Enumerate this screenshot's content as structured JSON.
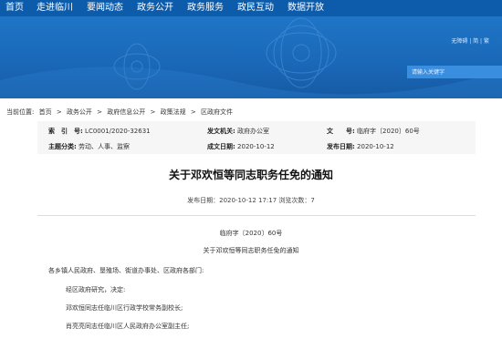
{
  "nav": {
    "items": [
      "首页",
      "走进临川",
      "要闻动态",
      "政务公开",
      "政务服务",
      "政民互动",
      "数据开放"
    ]
  },
  "header": {
    "accessibility_links": "无障碍 | 简 | 繁",
    "search_placeholder": "请输入关键字"
  },
  "breadcrumb": {
    "prefix": "当前位置:",
    "items": [
      "首页",
      "政务公开",
      "政府信息公开",
      "政策法规",
      "区政府文件"
    ],
    "separator": ">"
  },
  "meta": {
    "index_key": "索　引　号:",
    "index_val": "LC0001/2020-32631",
    "issuer_key": "发文机关:",
    "issuer_val": "政府办公室",
    "docno_key": "文　　号:",
    "docno_val": "临府字〔2020〕60号",
    "topic_key": "主题分类:",
    "topic_val": "劳动、人事、监察",
    "created_key": "成文日期:",
    "created_val": "2020-10-12",
    "published_key": "发布日期:",
    "published_val": "2020-10-12"
  },
  "article": {
    "title": "关于邓欢恒等同志职务任免的通知",
    "pubinfo": "发布日期：2020-10-12 17:17  浏览次数：7",
    "docno": "临府字〔2020〕60号",
    "subtitle": "关于邓欢恒等同志职务任免的通知",
    "salutation": "各乡镇人民政府、垦殖场、街道办事处、区政府各部门:",
    "para1": "经区政府研究，决定:",
    "para2": "邓欢恒同志任临川区行政学校常务副校长;",
    "para3": "肖亮亮同志任临川区人民政府办公室副主任;"
  },
  "colors": {
    "nav_bg": "#0d5cab",
    "banner_bg": "#1a67b7",
    "meta_bg": "#f6f6f6"
  }
}
